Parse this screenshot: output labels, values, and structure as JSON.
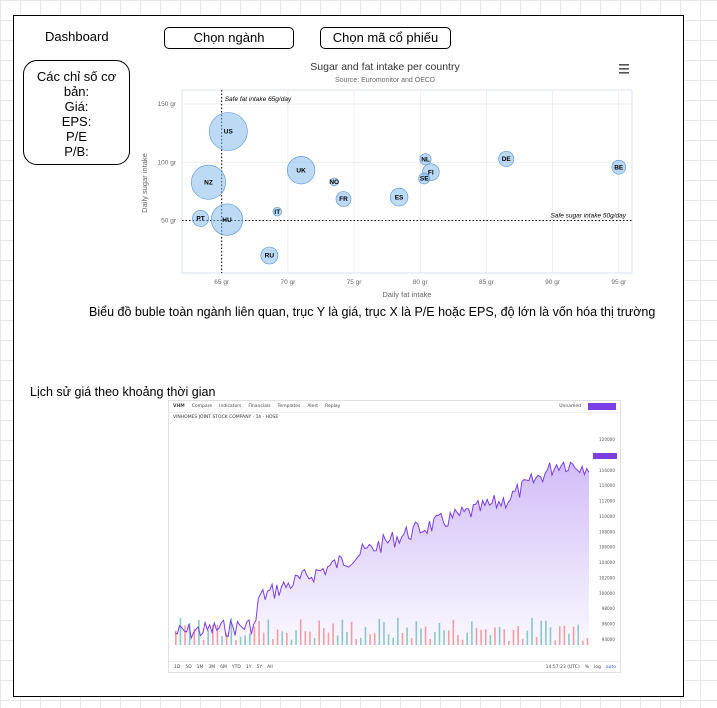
{
  "header": {
    "title": "Dashboard",
    "industry_button": "Chọn ngành",
    "stock_button": "Chọn mã cổ phiếu"
  },
  "stats": {
    "heading": "Các chỉ số cơ bản:",
    "items": [
      "Giá:",
      "EPS:",
      "P/E",
      "P/B:"
    ]
  },
  "bubble_caption": "Biểu đồ buble toàn ngành liên quan, trục Y là giá, trục X là P/E hoặc EPS, độ lớn là vốn hóa thị trường",
  "price_caption": "Lịch sử giá theo khoảng thời gian",
  "chart_data": [
    {
      "type": "scatter",
      "title": "Sugar and fat intake per country",
      "subtitle": "Source: Euromonitor and OECD",
      "xlabel": "Daily fat intake",
      "ylabel": "Daily sugar intake",
      "xlim": [
        62,
        96
      ],
      "ylim": [
        5,
        162
      ],
      "xticks": [
        "65 gr",
        "70 gr",
        "75 gr",
        "80 gr",
        "85 gr",
        "90 gr",
        "95 gr"
      ],
      "xtick_values": [
        65,
        70,
        75,
        80,
        85,
        90,
        95
      ],
      "yticks": [
        "50 gr",
        "100 gr",
        "150 gr"
      ],
      "ytick_values": [
        50,
        100,
        150
      ],
      "grid": true,
      "plotlines": [
        {
          "axis": "x",
          "value": 65,
          "label": "Safe fat intake 65g/day"
        },
        {
          "axis": "y",
          "value": 50,
          "label": "Safe sugar intake 50g/day"
        }
      ],
      "points": [
        {
          "name": "BE",
          "x": 95,
          "y": 95.8,
          "z": 13.8
        },
        {
          "name": "DE",
          "x": 86.5,
          "y": 102.9,
          "z": 14.7
        },
        {
          "name": "FI",
          "x": 80.8,
          "y": 91.5,
          "z": 15.8
        },
        {
          "name": "NL",
          "x": 80.4,
          "y": 102.5,
          "z": 12
        },
        {
          "name": "SE",
          "x": 80.3,
          "y": 86.1,
          "z": 11.8
        },
        {
          "name": "ES",
          "x": 78.4,
          "y": 70.1,
          "z": 16.6
        },
        {
          "name": "FR",
          "x": 74.2,
          "y": 68.5,
          "z": 14.5
        },
        {
          "name": "NO",
          "x": 73.5,
          "y": 83.1,
          "z": 10
        },
        {
          "name": "UK",
          "x": 71,
          "y": 93.2,
          "z": 24.7
        },
        {
          "name": "IT",
          "x": 69.2,
          "y": 57.6,
          "z": 10.4
        },
        {
          "name": "RU",
          "x": 68.6,
          "y": 20,
          "z": 16
        },
        {
          "name": "US",
          "x": 65.5,
          "y": 126.4,
          "z": 35.3
        },
        {
          "name": "HU",
          "x": 65.4,
          "y": 50.8,
          "z": 28.5
        },
        {
          "name": "PT",
          "x": 63.4,
          "y": 51.8,
          "z": 15.4
        },
        {
          "name": "NZ",
          "x": 64,
          "y": 82.9,
          "z": 31.3
        }
      ]
    }
  ],
  "price_chart": {
    "symbol": "VHM",
    "company": "VINHOMES JOINT STOCK COMPANY · 1h · HOSE",
    "toolbar": [
      "Compare",
      "Indicators",
      "Financials",
      "Templates",
      "Alert",
      "Replay"
    ],
    "layout": "Unnamed",
    "timeframes": [
      "1D",
      "5D",
      "1M",
      "3M",
      "6M",
      "YTD",
      "1Y",
      "5Y",
      "All"
    ],
    "time": "14:57:23 (UTC)",
    "bottom_right": [
      "%",
      "log",
      "auto"
    ],
    "price_labels": [
      "120000",
      "118000",
      "116000",
      "114000",
      "112000",
      "110000",
      "108000",
      "106000",
      "104000",
      "102000",
      "100000",
      "98000",
      "96000",
      "94000"
    ],
    "accent": "#7b3fe4"
  }
}
